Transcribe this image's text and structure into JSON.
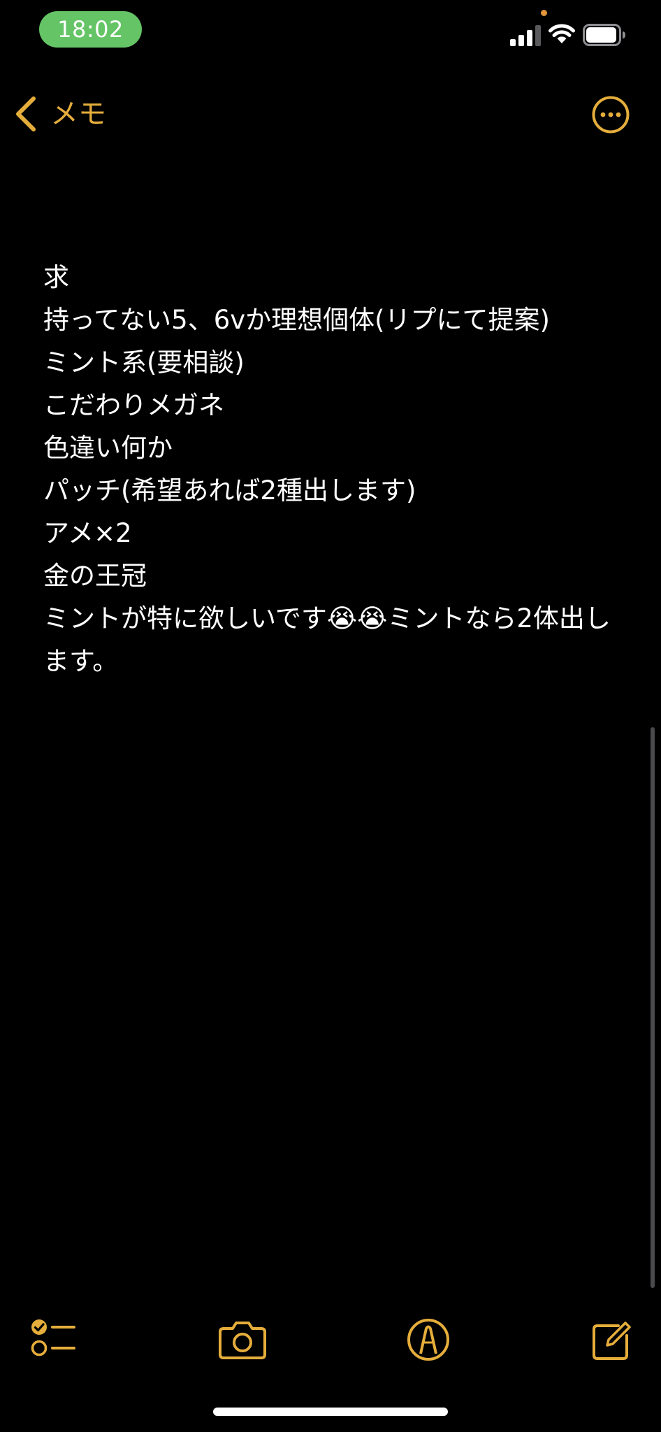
{
  "status_bar": {
    "time": "18:02",
    "signal_icon": "cellular-signal-icon",
    "wifi_icon": "wifi-icon",
    "battery_icon": "battery-icon"
  },
  "nav": {
    "back_label": "メモ",
    "back_icon": "chevron-left-icon",
    "more_icon": "ellipsis-circle-icon"
  },
  "note": {
    "lines": [
      "求",
      "持ってない5、6vか理想個体(リプにて提案)",
      "ミント系(要相談)",
      "こだわりメガネ",
      "色違い何か",
      "パッチ(希望あれば2種出します)",
      "アメ×2",
      "金の王冠",
      "ミントが特に欲しいです😭😭ミントなら2体出します。"
    ]
  },
  "toolbar": {
    "checklist_icon": "checklist-icon",
    "camera_icon": "camera-icon",
    "markup_icon": "markup-pen-icon",
    "compose_icon": "compose-icon"
  },
  "colors": {
    "accent": "#e5ad3b",
    "background": "#000000",
    "text": "#ffffff",
    "status_time_pill": "#65c466"
  }
}
